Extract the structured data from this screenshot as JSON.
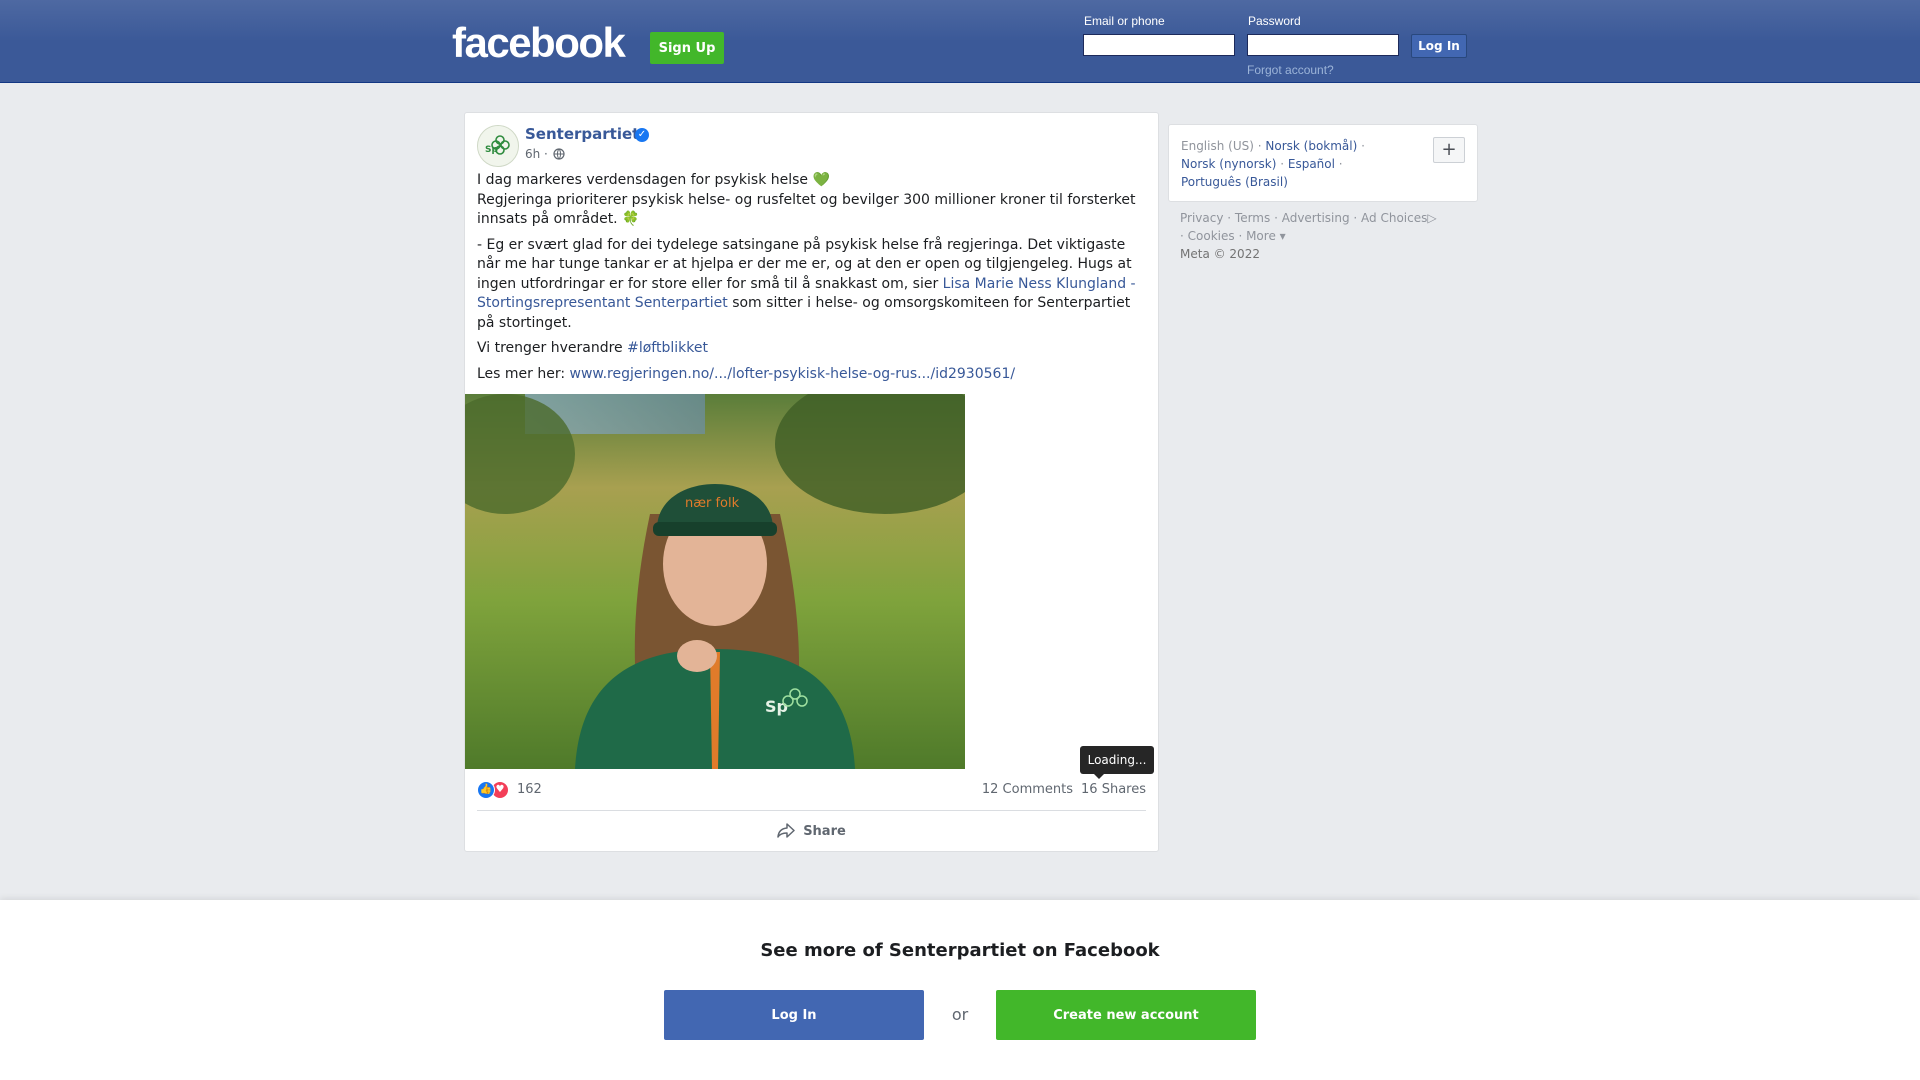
{
  "header": {
    "logo_text": "facebook",
    "signup_label": "Sign Up",
    "email_label": "Email or phone",
    "password_label": "Password",
    "login_label": "Log In",
    "forgot_label": "Forgot account?",
    "email_value": "",
    "password_value": ""
  },
  "post": {
    "page_name": "Senterpartiet",
    "time": "6h ·",
    "avatar_text": "Sp",
    "p1_line1": "I dag markeres verdensdagen for psykisk helse 💚",
    "p1_line2": "Regjeringa prioriterer psykisk helse- og rusfeltet og bevilger 300 millioner kroner til forsterket innsats på området. 🍀",
    "p2_text_before": "- Eg er svært glad for dei tydelege satsingane på psykisk helse frå regjeringa. Det viktigaste når me har tunge tankar er at hjelpa er der me er, og at den er open og tilgjengeleg. Hugs at ingen utfordringar er for store eller for små til å snakkast om, sier ",
    "p2_mention": "Lisa Marie Ness Klungland - Stortingsrepresentant Senterpartiet",
    "p2_text_after": " som sitter i helse- og omsorgskomiteen for Senterpartiet på stortinget.",
    "p3_text": "Vi trenger hverandre ",
    "p3_hashtag": "#løftblikket",
    "p4_text": "Les mer her: ",
    "p4_link": "www.regjeringen.no/.../lofter-psykisk-helse-og-rus.../id2930561/",
    "photo_cap_text": "nær folk",
    "photo_jacket_logo": "Sp",
    "reaction_count": "162",
    "comments": "12 Comments",
    "shares": "16 Shares",
    "tooltip": "Loading...",
    "share_label": "Share"
  },
  "sidebar": {
    "lang_current": "English (US)",
    "lang_norsk_bokmal": "Norsk (bokmål)",
    "lang_norsk_nynorsk": "Norsk (nynorsk)",
    "lang_espanol": "Español",
    "lang_portugues": "Português (Brasil)",
    "lang_add": "+",
    "footer_privacy": "Privacy",
    "footer_terms": "Terms",
    "footer_advertising": "Advertising",
    "footer_adchoices": "Ad Choices",
    "footer_cookies": "Cookies",
    "footer_more": "More",
    "footer_copyright": "Meta © 2022"
  },
  "bottom": {
    "title": "See more of Senterpartiet on Facebook",
    "login_label": "Log In",
    "or_label": "or",
    "create_label": "Create new account"
  },
  "colors": {
    "brand_blue": "#3b5998",
    "button_blue": "#4267b2",
    "green": "#42b72a",
    "link": "#385898"
  }
}
